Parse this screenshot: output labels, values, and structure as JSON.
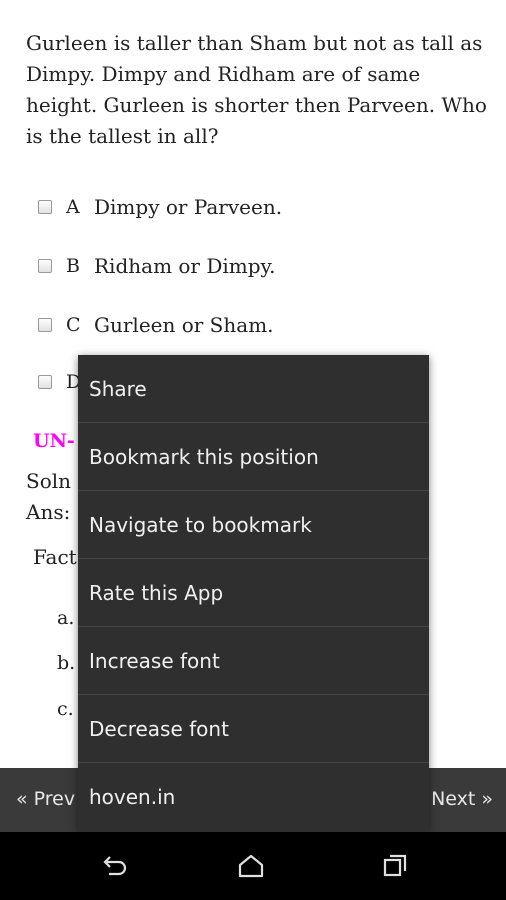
{
  "question": {
    "text": "Gurleen is taller than Sham but not as tall as Dimpy. Dimpy and Ridham are of same height. Gurleen is shorter then Parveen. Who is the tallest in all?"
  },
  "options": [
    {
      "letter": "A",
      "text": "Dimpy or Parveen."
    },
    {
      "letter": "B",
      "text": "Ridham or Dimpy."
    },
    {
      "letter": "C",
      "text": "Gurleen or Sham."
    },
    {
      "letter": "D",
      "text": ""
    }
  ],
  "answer_section": {
    "label_partial": "UN-",
    "soln_partial": "Soln",
    "ans_partial": "Ans:",
    "facts_partial": "Fact",
    "list_a": "a.",
    "list_b": "b.",
    "list_c": "c."
  },
  "bottom_nav": {
    "prev": "« Prev",
    "next": "Next »"
  },
  "menu": {
    "items": [
      "Share",
      "Bookmark this position",
      "Navigate to bookmark",
      "Rate this App",
      "Increase font",
      "Decrease font",
      "hoven.in"
    ]
  },
  "system_nav": {
    "back_icon": "back-icon",
    "home_icon": "home-icon",
    "recents_icon": "recents-icon"
  },
  "colors": {
    "section_label": "#ff00ff",
    "menu_background": "#2f2f2f",
    "bottom_bar": "#3a3a3a"
  }
}
